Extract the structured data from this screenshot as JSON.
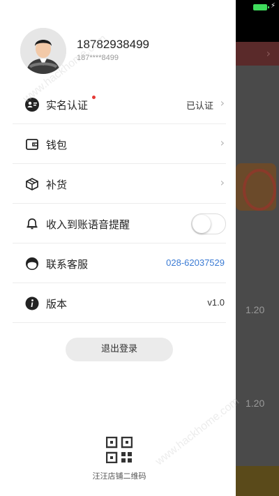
{
  "status": {
    "battery_color": "#3fdc5c"
  },
  "profile": {
    "phone": "18782938499",
    "phone_masked": "187****8499",
    "avatar_icon": "driver-avatar"
  },
  "menu": {
    "verify": {
      "label": "实名认证",
      "value": "已认证",
      "icon": "id-card-icon",
      "badge": true
    },
    "wallet": {
      "label": "钱包",
      "icon": "wallet-icon"
    },
    "restock": {
      "label": "补货",
      "icon": "box-icon"
    },
    "voice": {
      "label": "收入到账语音提醒",
      "icon": "bell-icon",
      "enabled": false
    },
    "support": {
      "label": "联系客服",
      "value": "028-62037529",
      "icon": "headset-icon"
    },
    "version": {
      "label": "版本",
      "value": "v1.0",
      "icon": "info-icon"
    }
  },
  "logout_label": "退出登录",
  "qr_label": "汪汪店铺二维码",
  "background": {
    "price_1": "1.20",
    "price_2": "1.20"
  },
  "watermark_text": "www.hackhome.com"
}
